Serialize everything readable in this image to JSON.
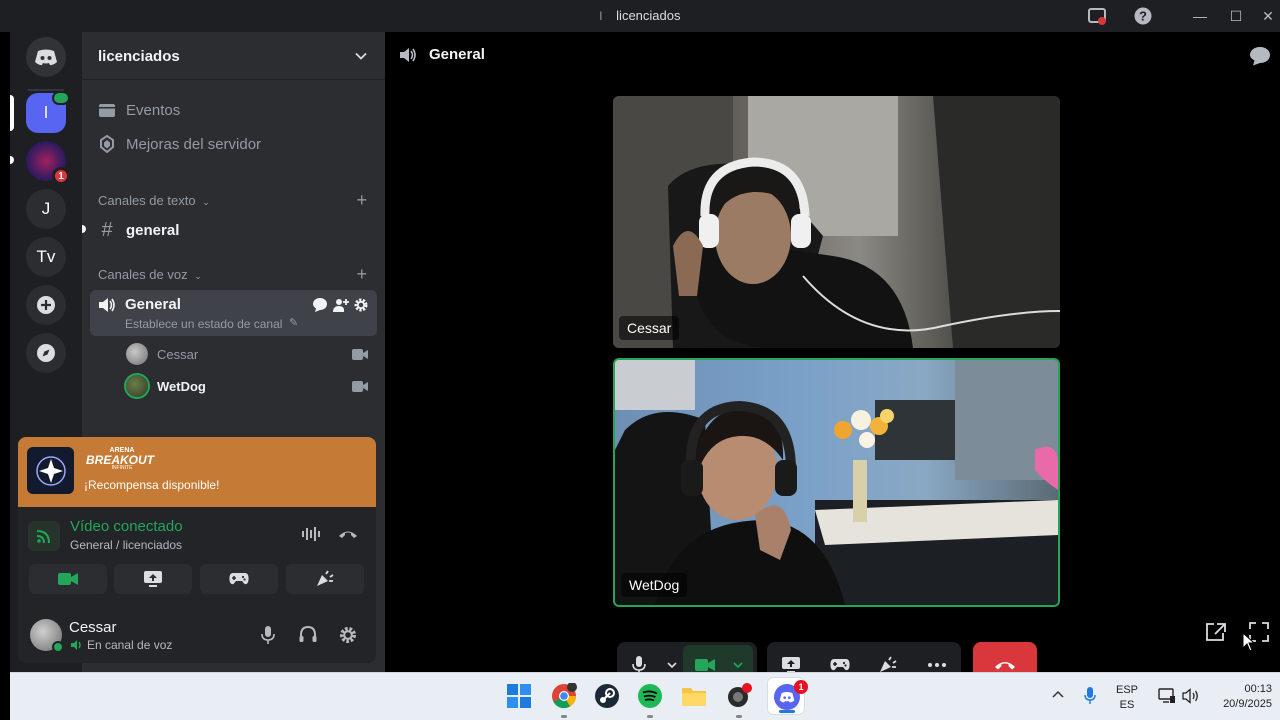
{
  "window": {
    "title_prefix": "l",
    "title": "licenciados",
    "minimize": "—",
    "maximize": "☐",
    "close": "✕"
  },
  "server_rail": {
    "servers": [
      {
        "label": "l",
        "selected": true
      },
      {
        "label": "",
        "badge": "1"
      },
      {
        "label": "J"
      },
      {
        "label": "Tv"
      }
    ]
  },
  "sidebar": {
    "server_name": "licenciados",
    "items": [
      {
        "label": "Eventos",
        "icon": "calendar-icon"
      },
      {
        "label": "Mejoras del servidor",
        "icon": "boost-icon"
      }
    ],
    "text_category": "Canales de texto",
    "text_channels": [
      {
        "name": "general"
      }
    ],
    "voice_category": "Canales de voz",
    "voice_channel": {
      "name": "General",
      "status_placeholder": "Establece un estado de canal"
    },
    "voice_members": [
      {
        "name": "Cessar",
        "speaking": false
      },
      {
        "name": "WetDog",
        "speaking": true
      }
    ]
  },
  "reward_banner": {
    "brand_line1": "ARENA",
    "brand_line2": "BREAKOUT",
    "brand_line3": "INFINITE",
    "text": "¡Recompensa disponible!"
  },
  "voice_connection": {
    "status": "Vídeo conectado",
    "location": "General / licenciados"
  },
  "user_panel": {
    "username": "Cessar",
    "status": "En canal de voz"
  },
  "main": {
    "channel_name": "General",
    "tiles": [
      {
        "name": "Cessar",
        "speaking": false
      },
      {
        "name": "WetDog",
        "speaking": true
      }
    ]
  },
  "taskbar": {
    "lang_line1": "ESP",
    "lang_line2": "ES",
    "time": "00:13",
    "date": "20/9/2025",
    "discord_badge": "1"
  },
  "colors": {
    "accent": "#5865f2",
    "connected_green": "#23a55a",
    "hangup_red": "#da373c",
    "speaking_border": "#23a55a",
    "reward_bg": "#c57a35"
  }
}
